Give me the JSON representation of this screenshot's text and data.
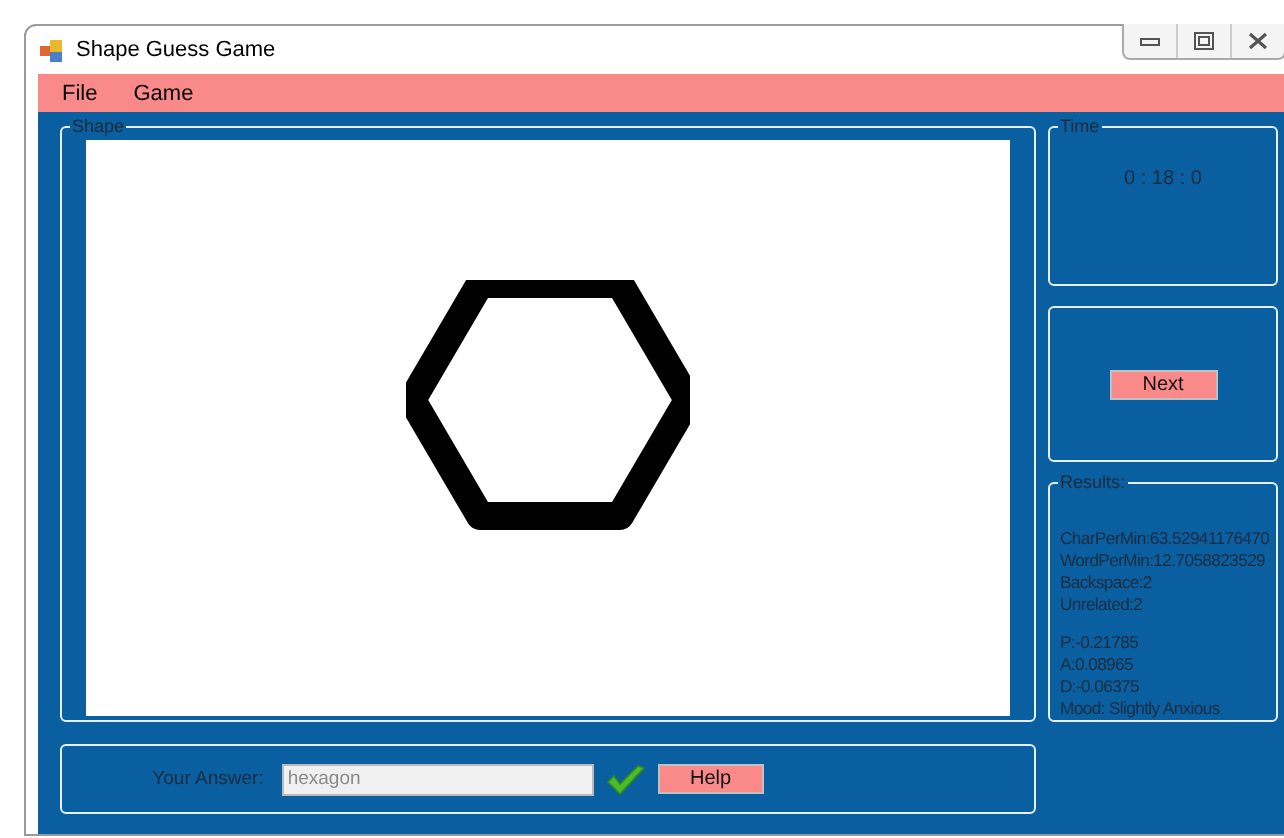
{
  "window": {
    "title": "Shape Guess Game"
  },
  "menu": [
    {
      "label": "File"
    },
    {
      "label": "Game"
    }
  ],
  "shape_panel": {
    "title": "Shape",
    "shape": {
      "kind": "hexagon"
    }
  },
  "time_panel": {
    "title": "Time",
    "value": "0 : 18 : 0"
  },
  "next_button": {
    "label": "Next"
  },
  "results_panel": {
    "title": "Results:",
    "lines": [
      "CharPerMin:63.52941176470",
      "WordPerMin:12.7058823529",
      "Backspace:2",
      "Unrelated:2"
    ],
    "mood_lines": [
      "P:-0.21785",
      "A:0.08965",
      "D:-0.06375",
      "Mood: Slightly Anxious"
    ]
  },
  "answer": {
    "label": "Your Answer:",
    "value": "hexagon",
    "disabled": true,
    "correct": true
  },
  "help_button": {
    "label": "Help"
  }
}
